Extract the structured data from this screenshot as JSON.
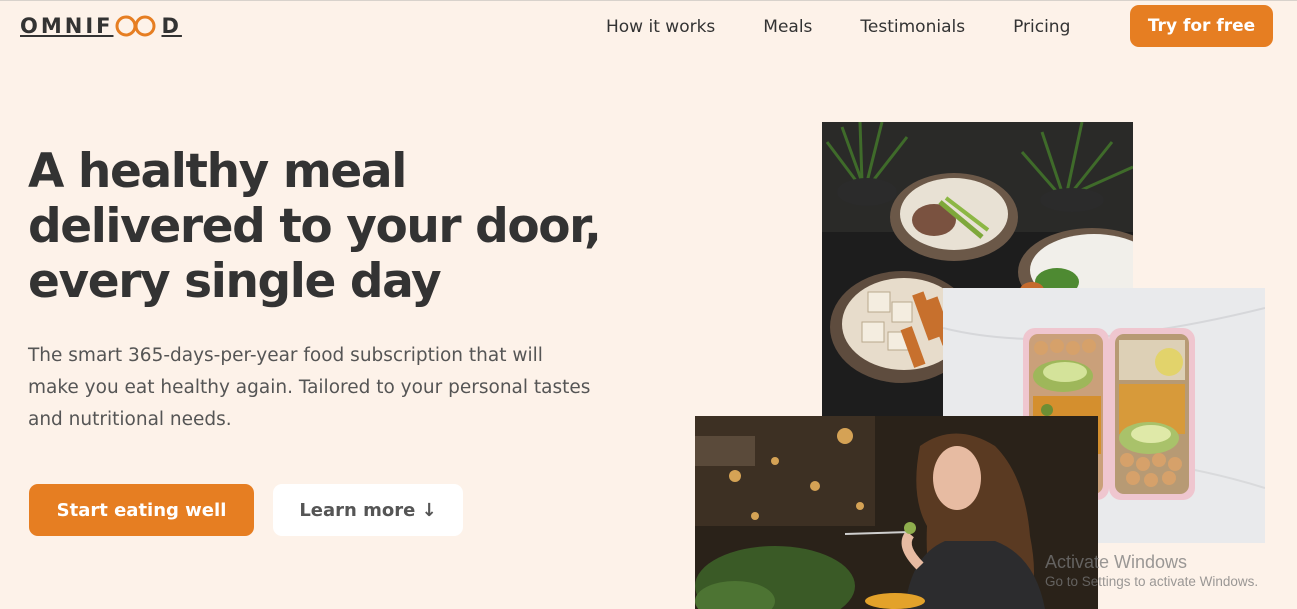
{
  "brand": {
    "name_prefix": "OMNIF",
    "name_suffix": "D"
  },
  "nav": {
    "items": [
      "How it works",
      "Meals",
      "Testimonials",
      "Pricing"
    ],
    "cta": "Try for free"
  },
  "hero": {
    "title_lines": [
      "A healthy meal",
      "delivered to your door,",
      "every single day"
    ],
    "description": "The smart 365-days-per-year food subscription that will make you eat healthy again. Tailored to your personal tastes and nutritional needs.",
    "primary_button": "Start eating well",
    "secondary_button": "Learn more ↓"
  },
  "images": {
    "bowls": "food-bowls-photo",
    "boxes": "meal-prep-boxes-photo",
    "woman": "woman-eating-photo"
  },
  "watermark": {
    "title": "Activate Windows",
    "subtitle": "Go to Settings to activate Windows."
  },
  "colors": {
    "accent": "#e67e22",
    "background": "#fdf2e9",
    "text": "#333333"
  }
}
